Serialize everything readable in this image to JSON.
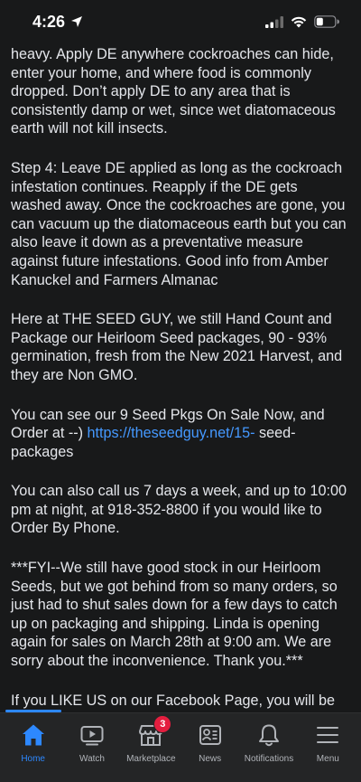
{
  "status_bar": {
    "time": "4:26"
  },
  "post": {
    "paragraphs": [
      "heavy. Apply DE anywhere cockroaches can hide, enter your home, and where food is commonly dropped. Don’t apply DE to any area that is consistently damp or wet, since wet diatomaceous earth will not kill insects.",
      "Step 4: Leave DE applied as long as the cockroach infestation continues. Reapply if the DE gets washed away. Once the cockroaches are gone, you can vacuum up the diatomaceous earth but you can also leave it down as a preventative measure against future infestations. Good info from Amber Kanuckel and Farmers Almanac",
      "Here at THE SEED GUY, we still Hand Count and Package our Heirloom Seed packages, 90 - 93% germination, fresh from the New 2021 Harvest, and they are Non GMO.",
      "You can also call us 7 days a week, and up to 10:00 pm at night, at 918-352-8800 if you would like to Order By Phone.",
      "***FYI--We still have good stock in our Heirloom Seeds, but we got behind from so many orders, so just had to shut sales down for a few days to catch up on packaging and shipping. Linda is opening again for sales on March 28th at 9:00 am. We are sorry about the inconvenience. Thank you.***",
      "If you LIKE US on our Facebook Page, you will be able to see more of our New Seed Offerings, great"
    ],
    "order_paragraph": {
      "before": "You can see our 9 Seed Pkgs On Sale Now, and Order at --) ",
      "link": "https://theseedguy.net/15-",
      "after": " seed-packages"
    }
  },
  "tab_bar": {
    "tabs": [
      {
        "label": "Home",
        "icon": "home-icon",
        "active": true
      },
      {
        "label": "Watch",
        "icon": "watch-icon"
      },
      {
        "label": "Marketplace",
        "icon": "marketplace-icon",
        "badge": "3"
      },
      {
        "label": "News",
        "icon": "news-icon"
      },
      {
        "label": "Notifications",
        "icon": "bell-icon"
      },
      {
        "label": "Menu",
        "icon": "menu-icon"
      }
    ]
  },
  "colors": {
    "background": "#18191a",
    "text": "#e4e6eb",
    "link": "#4599ff",
    "accent": "#2d88ff",
    "badge": "#e41e3f"
  }
}
